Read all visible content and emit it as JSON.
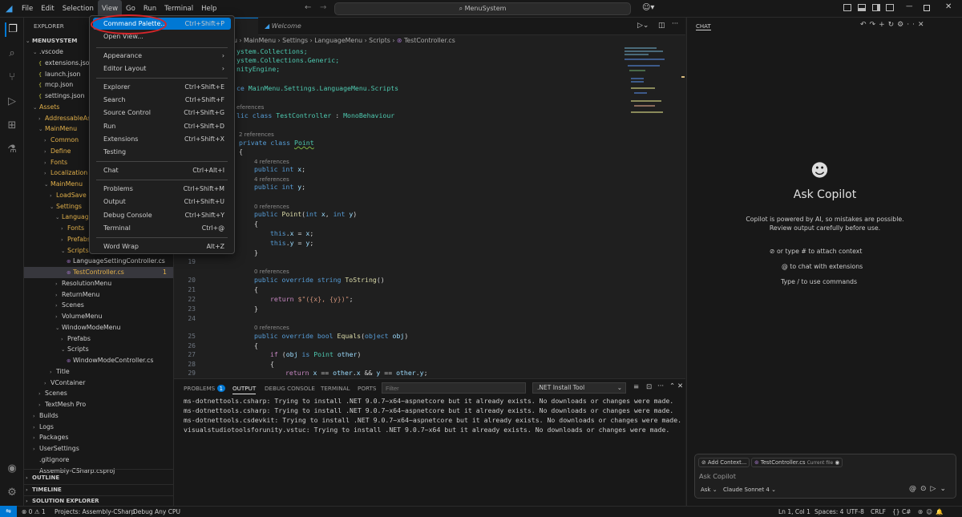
{
  "titlebar": {
    "menus": [
      "File",
      "Edit",
      "Selection",
      "View",
      "Go",
      "Run",
      "Terminal",
      "Help"
    ],
    "search": "MenuSystem"
  },
  "view_menu": {
    "items": [
      {
        "label": "Command Palette...",
        "kb": "Ctrl+Shift+P"
      },
      {
        "label": "Open View...",
        "kb": ""
      },
      {
        "label": "Appearance",
        "kb": ""
      },
      {
        "label": "Editor Layout",
        "kb": ""
      },
      {
        "label": "Explorer",
        "kb": "Ctrl+Shift+E"
      },
      {
        "label": "Search",
        "kb": "Ctrl+Shift+F"
      },
      {
        "label": "Source Control",
        "kb": "Ctrl+Shift+G"
      },
      {
        "label": "Run",
        "kb": "Ctrl+Shift+D"
      },
      {
        "label": "Extensions",
        "kb": "Ctrl+Shift+X"
      },
      {
        "label": "Testing",
        "kb": ""
      },
      {
        "label": "Chat",
        "kb": "Ctrl+Alt+I"
      },
      {
        "label": "Problems",
        "kb": "Ctrl+Shift+M"
      },
      {
        "label": "Output",
        "kb": "Ctrl+Shift+U"
      },
      {
        "label": "Debug Console",
        "kb": "Ctrl+Shift+Y"
      },
      {
        "label": "Terminal",
        "kb": "Ctrl+@"
      },
      {
        "label": "Word Wrap",
        "kb": "Alt+Z"
      }
    ]
  },
  "explorer": {
    "title": "EXPLORER",
    "root": "MENUSYSTEM",
    "rows": [
      ".vscode",
      "extensions.json",
      "launch.json",
      "mcp.json",
      "settings.json",
      "Assets",
      "AddressableAs...",
      "MainMenu",
      "Common",
      "Define",
      "Fonts",
      "Localization",
      "MainMenu",
      "LoadSave",
      "Settings",
      "LanguageM...",
      "Fonts",
      "Prefabs",
      "Scripts",
      "LanguageSettingController.cs",
      "TestController.cs",
      "ResolutionMenu",
      "ReturnMenu",
      "Scenes",
      "VolumeMenu",
      "WindowModeMenu",
      "Prefabs",
      "Scripts",
      "WindowModeController.cs",
      "Title",
      "VContainer",
      "Scenes",
      "TextMesh Pro",
      "Builds",
      "Logs",
      "Packages",
      "UserSettings",
      ".gitignore",
      "Assembly-CSharp.csproj"
    ],
    "badge": "1",
    "sections": [
      "OUTLINE",
      "TIMELINE",
      "SOLUTION EXPLORER"
    ]
  },
  "editor": {
    "tabs": [
      "Welcome"
    ],
    "breadcrumb": [
      "u",
      "MainMenu",
      "Settings",
      "LanguageMenu",
      "Scripts",
      "TestController.cs"
    ],
    "line_numbers": [
      "19",
      "20",
      "21",
      "22",
      "23",
      "24",
      "25",
      "26",
      "27",
      "28",
      "29"
    ]
  },
  "panel": {
    "tabs": [
      "PROBLEMS",
      "OUTPUT",
      "DEBUG CONSOLE",
      "TERMINAL",
      "PORTS"
    ],
    "problems_count": "1",
    "filter_placeholder": "Filter",
    "channel": ".NET Install Tool",
    "output": [
      "ms-dotnettools.csharp: Trying to install .NET 9.0.7~x64~aspnetcore but it already exists. No downloads or changes were made.",
      "ms-dotnettools.csharp: Trying to install .NET 9.0.7~x64~aspnetcore but it already exists. No downloads or changes were made.",
      "ms-dotnettools.csdevkit: Trying to install .NET 9.0.7~x64~aspnetcore but it already exists. No downloads or changes were made.",
      "visualstudiotoolsforunity.vstuc: Trying to install .NET 9.0.7~x64 but it already exists. No downloads or changes were made."
    ]
  },
  "chat": {
    "header": "CHAT",
    "title": "Ask Copilot",
    "disclaimer": "Copilot is powered by AI, so mistakes are possible. Review output carefully before use.",
    "hints": [
      "or type # to attach context",
      "to chat with extensions",
      "Type / to use commands"
    ],
    "add_context": "Add Context...",
    "file_chip": "TestController.cs",
    "file_chip_note": "Current file",
    "input_placeholder": "Ask Copilot",
    "mode": "Ask",
    "model": "Claude Sonnet 4"
  },
  "statusbar": {
    "problems": "0",
    "warnings": "1",
    "project": "Projects: Assembly-CSharp",
    "config": "Debug Any CPU",
    "position": "Ln 1, Col 1",
    "spaces": "Spaces: 4",
    "encoding": "UTF-8",
    "eol": "CRLF",
    "lang": "C#"
  }
}
